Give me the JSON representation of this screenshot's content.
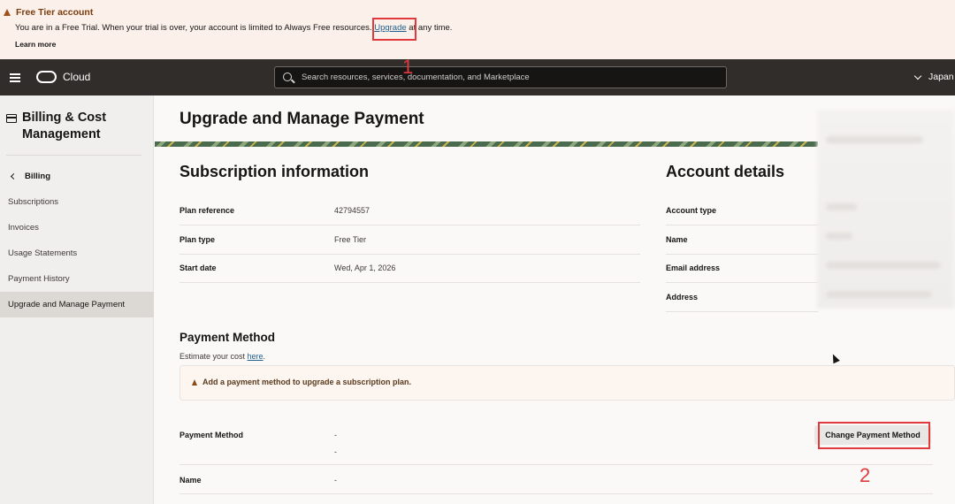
{
  "banner": {
    "title": "Free Tier account",
    "message_pre": "You are in a Free Trial. When your trial is over, your account is limited to Always Free resources. ",
    "upgrade_link": "Upgrade",
    "message_post": " at any time.",
    "learn_more": "Learn more"
  },
  "nav": {
    "brand": "Cloud",
    "search_placeholder": "Search resources, services, documentation, and Marketplace",
    "region": "Japan"
  },
  "sidebar": {
    "title": "Billing & Cost Management",
    "back_label": "Billing",
    "items": [
      {
        "label": "Subscriptions"
      },
      {
        "label": "Invoices"
      },
      {
        "label": "Usage Statements"
      },
      {
        "label": "Payment History"
      },
      {
        "label": "Upgrade and Manage Payment",
        "active": true
      }
    ]
  },
  "main": {
    "page_title": "Upgrade and Manage Payment",
    "subscription": {
      "title": "Subscription information",
      "rows": [
        {
          "label": "Plan reference",
          "value": "42794557"
        },
        {
          "label": "Plan type",
          "value": "Free Tier"
        },
        {
          "label": "Start date",
          "value": "Wed, Apr 1, 2026"
        }
      ]
    },
    "account": {
      "title": "Account details",
      "rows": [
        {
          "label": "Account type"
        },
        {
          "label": "Name"
        },
        {
          "label": "Email address"
        },
        {
          "label": "Address"
        }
      ]
    },
    "payment": {
      "title": "Payment Method",
      "estimate_pre": "Estimate your cost ",
      "estimate_link": "here",
      "estimate_post": ".",
      "alert": "Add a payment method to upgrade a subscription plan.",
      "method_label": "Payment Method",
      "method_value_1": "-",
      "method_value_2": "-",
      "change_button": "Change Payment Method",
      "name_label": "Name",
      "name_value": "-"
    }
  },
  "annotations": {
    "one": "1",
    "two": "2",
    "color": "#e0393e"
  }
}
